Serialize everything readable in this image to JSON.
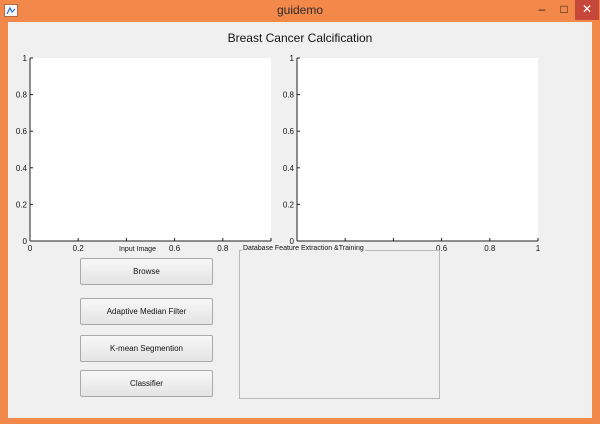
{
  "window": {
    "title": "guidemo",
    "controls": {
      "minimize": "–",
      "maximize": "□",
      "close": "✕"
    },
    "icon": "matlab-figure-icon"
  },
  "figure": {
    "title": "Breast Cancer Calcification"
  },
  "axes_left": {
    "y_ticks": [
      "1",
      "0.8",
      "0.6",
      "0.4",
      "0.2",
      "0"
    ],
    "x_ticks": [
      "0",
      "0.2",
      "0.4",
      "0.6",
      "0.8",
      "1"
    ],
    "x_tick_labels_visible": [
      "0",
      "0.2",
      "",
      "0.6",
      "0.8",
      ""
    ],
    "xlim": [
      0,
      1
    ],
    "ylim": [
      0,
      1
    ],
    "caption": "Input Image"
  },
  "axes_right": {
    "y_ticks": [
      "1",
      "0.8",
      "0.6",
      "0.4",
      "0.2",
      "0"
    ],
    "x_ticks": [
      "0",
      "0.2",
      "0.4",
      "0.6",
      "0.8",
      "1"
    ],
    "x_tick_labels_visible": [
      "",
      "",
      "",
      "0.6",
      "0.8",
      "1"
    ],
    "xlim": [
      0,
      1
    ],
    "ylim": [
      0,
      1
    ]
  },
  "panel": {
    "title": "Database Feature Extraction &Training"
  },
  "buttons": {
    "browse": "Browse",
    "median": "Adaptive Median Filter",
    "kmean": "K-mean Segmention",
    "classifier": "Classifier"
  }
}
